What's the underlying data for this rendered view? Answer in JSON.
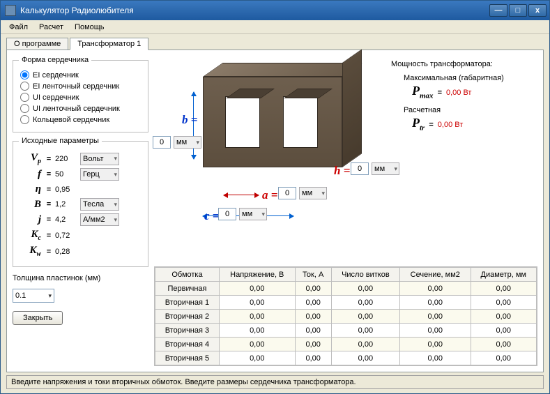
{
  "window": {
    "title": "Калькулятор Радиолюбителя"
  },
  "menu": {
    "file": "Файл",
    "calc": "Расчет",
    "help": "Помощь"
  },
  "tabs": {
    "about": "О программе",
    "trans1": "Трансформатор 1"
  },
  "coreForm": {
    "legend": "Форма сердечника",
    "o1": "EI сердечник",
    "o2": "EI ленточный сердечник",
    "o3": "UI сердечник",
    "o4": "UI ленточный сердечник",
    "o5": "Кольцевой сердечник"
  },
  "params": {
    "legend": "Исходные параметры",
    "vp": "220",
    "vp_unit": "Вольт",
    "f": "50",
    "f_unit": "Герц",
    "eta": "0,95",
    "b": "1,2",
    "b_unit": "Тесла",
    "j": "4,2",
    "j_unit": "А/мм2",
    "kc": "0,72",
    "kw": "0,28"
  },
  "thickness": {
    "label": "Толщина пластинок (мм)",
    "value": "0.1"
  },
  "close_btn": "Закрыть",
  "dims": {
    "b_lbl": "b =",
    "b_val": "0",
    "b_unit": "мм",
    "a_lbl": "a =",
    "a_val": "0",
    "a_unit": "мм",
    "c_lbl": "c =",
    "c_val": "0",
    "c_unit": "мм",
    "h_lbl": "h =",
    "h_val": "0",
    "h_unit": "мм"
  },
  "power": {
    "hdr": "Мощность трансформатора:",
    "max_lbl": "Максимальная (габаритная)",
    "pmax_val": "0,00 Вт",
    "calc_lbl": "Расчетная",
    "ptr_val": "0,00 Вт"
  },
  "table": {
    "h1": "Обмотка",
    "h2": "Напряжение, В",
    "h3": "Ток, А",
    "h4": "Число витков",
    "h5": "Сечение, мм2",
    "h6": "Диаметр, мм",
    "rows": [
      {
        "n": "Первичная",
        "v": "0,00",
        "i": "0,00",
        "t": "0,00",
        "s": "0,00",
        "d": "0,00"
      },
      {
        "n": "Вторичная 1",
        "v": "0,00",
        "i": "0,00",
        "t": "0,00",
        "s": "0,00",
        "d": "0,00"
      },
      {
        "n": "Вторичная 2",
        "v": "0,00",
        "i": "0,00",
        "t": "0,00",
        "s": "0,00",
        "d": "0,00"
      },
      {
        "n": "Вторичная 3",
        "v": "0,00",
        "i": "0,00",
        "t": "0,00",
        "s": "0,00",
        "d": "0,00"
      },
      {
        "n": "Вторичная 4",
        "v": "0,00",
        "i": "0,00",
        "t": "0,00",
        "s": "0,00",
        "d": "0,00"
      },
      {
        "n": "Вторичная 5",
        "v": "0,00",
        "i": "0,00",
        "t": "0,00",
        "s": "0,00",
        "d": "0,00"
      }
    ]
  },
  "status": "Введите напряжения и токи вторичных обмоток. Введите размеры сердечника трансформатора."
}
